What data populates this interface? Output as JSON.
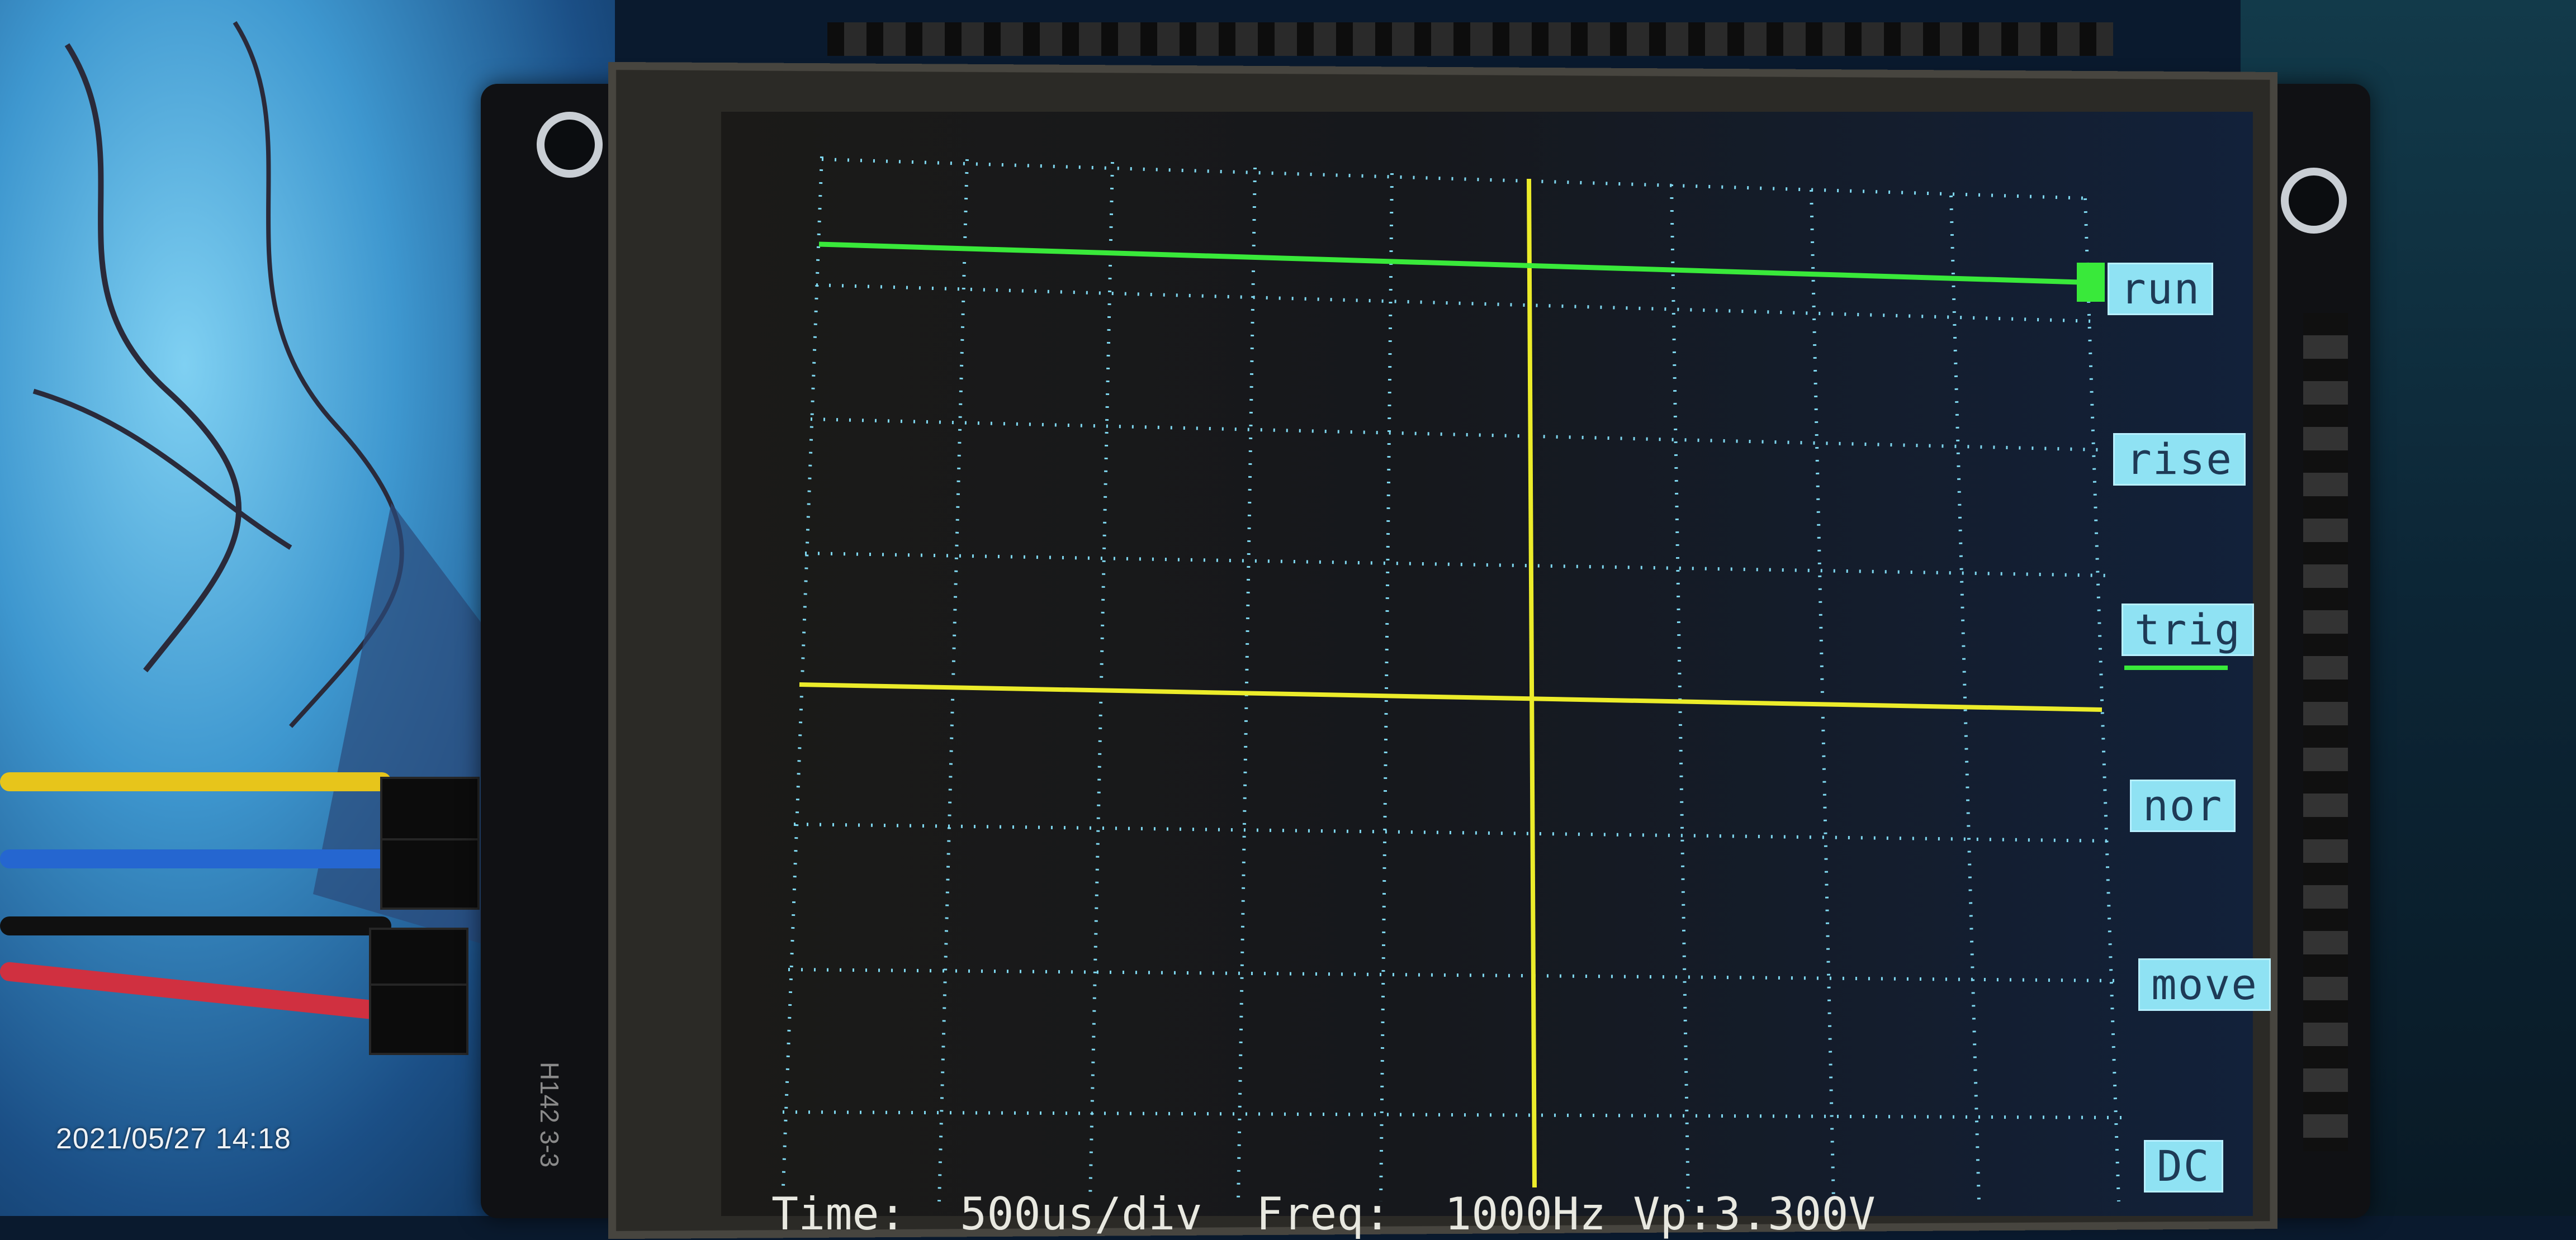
{
  "photo": {
    "timestamp": "2021/05/27 14:18",
    "silkscreen_text": "H142 3-3"
  },
  "scope": {
    "softkeys": [
      {
        "id": "run",
        "label": "run"
      },
      {
        "id": "rise",
        "label": "rise"
      },
      {
        "id": "trig",
        "label": "trig"
      },
      {
        "id": "nor",
        "label": "nor"
      },
      {
        "id": "move",
        "label": "move"
      },
      {
        "id": "dc",
        "label": "DC"
      }
    ],
    "status_line": "Time:  500us/div  Freq:  1000Hz Vp:3.300V",
    "grid": {
      "columns": 9,
      "rows": 8,
      "dot_color": "#7fd8f0"
    },
    "traces": {
      "signal_color": "#39e93a",
      "trigger_color": "#ecec2a",
      "cursor_color": "#ecec2a"
    }
  }
}
